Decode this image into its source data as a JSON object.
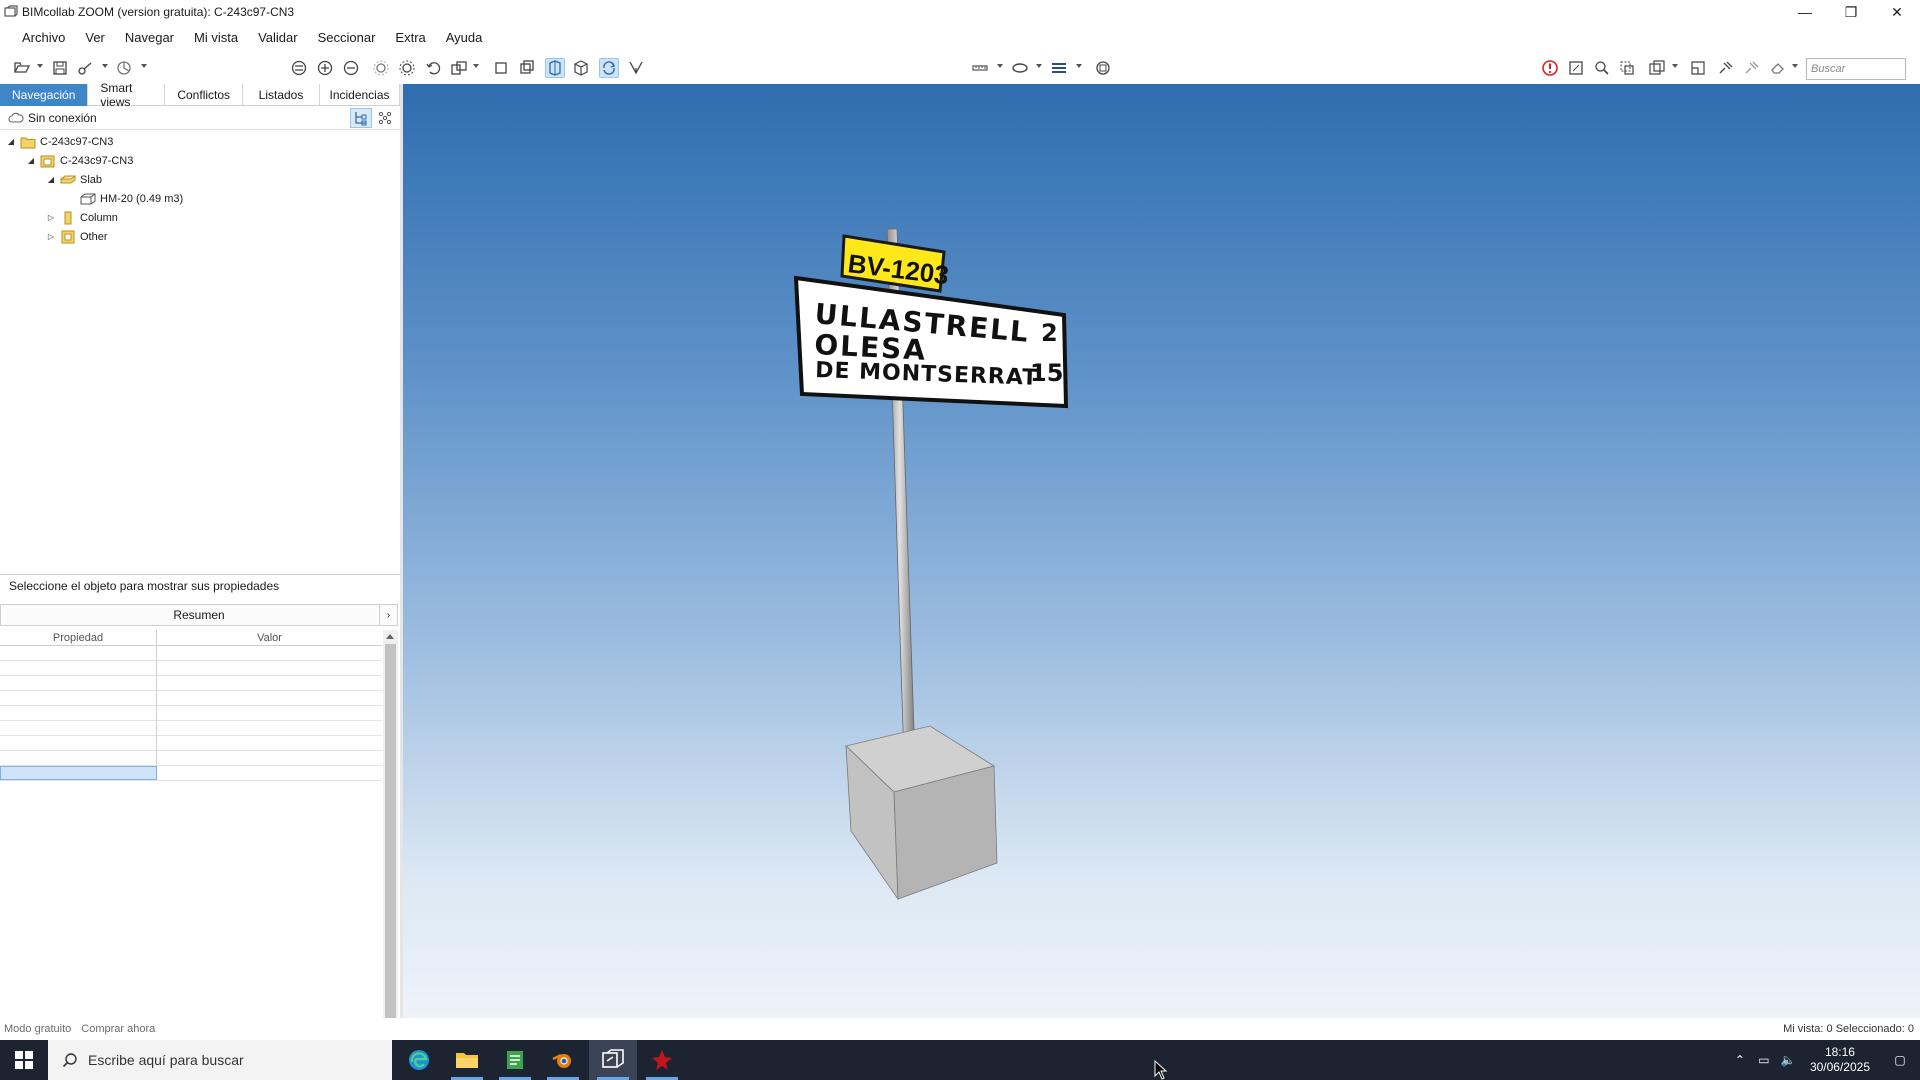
{
  "window": {
    "title": "BIMcollab ZOOM (version gratuita): C-243c97-CN3",
    "minimize": "—",
    "restore": "❐",
    "close": "✕"
  },
  "menu": [
    "Archivo",
    "Ver",
    "Navegar",
    "Mi vista",
    "Validar",
    "Seccionar",
    "Extra",
    "Ayuda"
  ],
  "toolbar": {
    "search_placeholder": "Buscar"
  },
  "tabs": [
    "Navegación",
    "Smart views",
    "Conflictos",
    "Listados",
    "Incidencias"
  ],
  "connection": "Sin conexión",
  "tree": [
    {
      "label": "C-243c97-CN3",
      "level": 0,
      "toggle": "◢"
    },
    {
      "label": "C-243c97-CN3",
      "level": 1,
      "toggle": "◢"
    },
    {
      "label": "Slab",
      "level": 2,
      "toggle": "◢"
    },
    {
      "label": "HM-20 (0.49 m3)",
      "level": 3,
      "toggle": ""
    },
    {
      "label": "Column",
      "level": 2,
      "toggle": "▷"
    },
    {
      "label": "Other",
      "level": 2,
      "toggle": "▷"
    }
  ],
  "properties": {
    "title": "Seleccione el objeto para mostrar sus propiedades",
    "summary": "Resumen",
    "expand": "›",
    "col_property": "Propiedad",
    "col_value": "Valor"
  },
  "model": {
    "road_sign": "BV-1203",
    "sign_lines": [
      "ULLASTRELL",
      "OLESA",
      "DE MONTSERRAT"
    ],
    "sign_distances": [
      "2",
      "15"
    ]
  },
  "status": {
    "mode": "Modo gratuito",
    "buy": "Comprar ahora",
    "counts": "Mi vista: 0  Seleccionado: 0"
  },
  "taskbar": {
    "search": "Escribe aquí para buscar",
    "time": "18:16",
    "date": "30/06/2025"
  },
  "colors": {
    "tab_active": "#3f86c8",
    "sign_yellow": "#ffe81a",
    "sky_top": "#2f6db0",
    "sky_bottom": "#eef3f9"
  }
}
